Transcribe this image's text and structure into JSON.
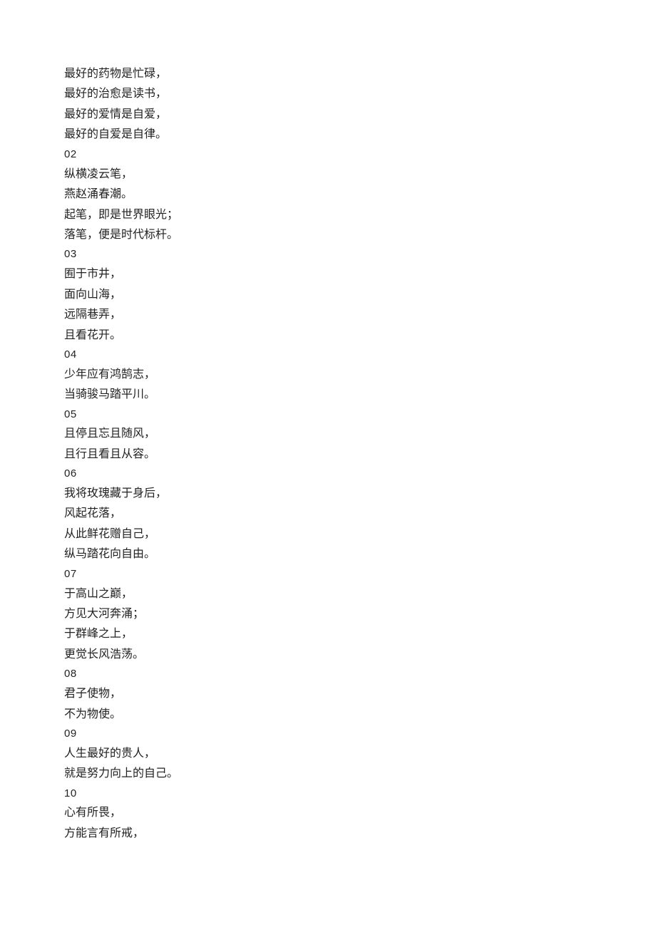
{
  "lines": [
    {
      "cls": "line",
      "text": "最好的药物是忙碌，"
    },
    {
      "cls": "line",
      "text": "最好的治愈是读书，"
    },
    {
      "cls": "line",
      "text": "最好的爱情是自爱，"
    },
    {
      "cls": "line",
      "text": "最好的自爱是自律。"
    },
    {
      "cls": "line num",
      "text": "02"
    },
    {
      "cls": "line",
      "text": "纵横凌云笔，"
    },
    {
      "cls": "line",
      "text": "燕赵涌春潮。"
    },
    {
      "cls": "line",
      "text": "起笔，即是世界眼光；"
    },
    {
      "cls": "line",
      "text": "落笔，便是时代标杆。"
    },
    {
      "cls": "line num",
      "text": "03"
    },
    {
      "cls": "line",
      "text": "囿于市井，"
    },
    {
      "cls": "line",
      "text": "面向山海，"
    },
    {
      "cls": "line",
      "text": "远隔巷弄，"
    },
    {
      "cls": "line",
      "text": "且看花开。"
    },
    {
      "cls": "line num",
      "text": "04"
    },
    {
      "cls": "line",
      "text": "少年应有鸿鹄志，"
    },
    {
      "cls": "line",
      "text": "当骑骏马踏平川。"
    },
    {
      "cls": "line num",
      "text": "05"
    },
    {
      "cls": "line",
      "text": "且停且忘且随风，"
    },
    {
      "cls": "line",
      "text": "且行且看且从容。"
    },
    {
      "cls": "line num",
      "text": "06"
    },
    {
      "cls": "line",
      "text": "我将玫瑰藏于身后，"
    },
    {
      "cls": "line",
      "text": "风起花落，"
    },
    {
      "cls": "line",
      "text": "从此鲜花赠自己，"
    },
    {
      "cls": "line",
      "text": "纵马踏花向自由。"
    },
    {
      "cls": "line num",
      "text": "07"
    },
    {
      "cls": "line",
      "text": "于高山之巅，"
    },
    {
      "cls": "line",
      "text": "方见大河奔涌；"
    },
    {
      "cls": "line",
      "text": "于群峰之上，"
    },
    {
      "cls": "line",
      "text": "更觉长风浩荡。"
    },
    {
      "cls": "line num",
      "text": "08"
    },
    {
      "cls": "line",
      "text": "君子使物，"
    },
    {
      "cls": "line",
      "text": "不为物使。"
    },
    {
      "cls": "line num",
      "text": "09"
    },
    {
      "cls": "line",
      "text": "人生最好的贵人，"
    },
    {
      "cls": "line",
      "text": "就是努力向上的自己。"
    },
    {
      "cls": "line num",
      "text": "10"
    },
    {
      "cls": "line",
      "text": "心有所畏，"
    },
    {
      "cls": "line",
      "text": "方能言有所戒，"
    }
  ]
}
